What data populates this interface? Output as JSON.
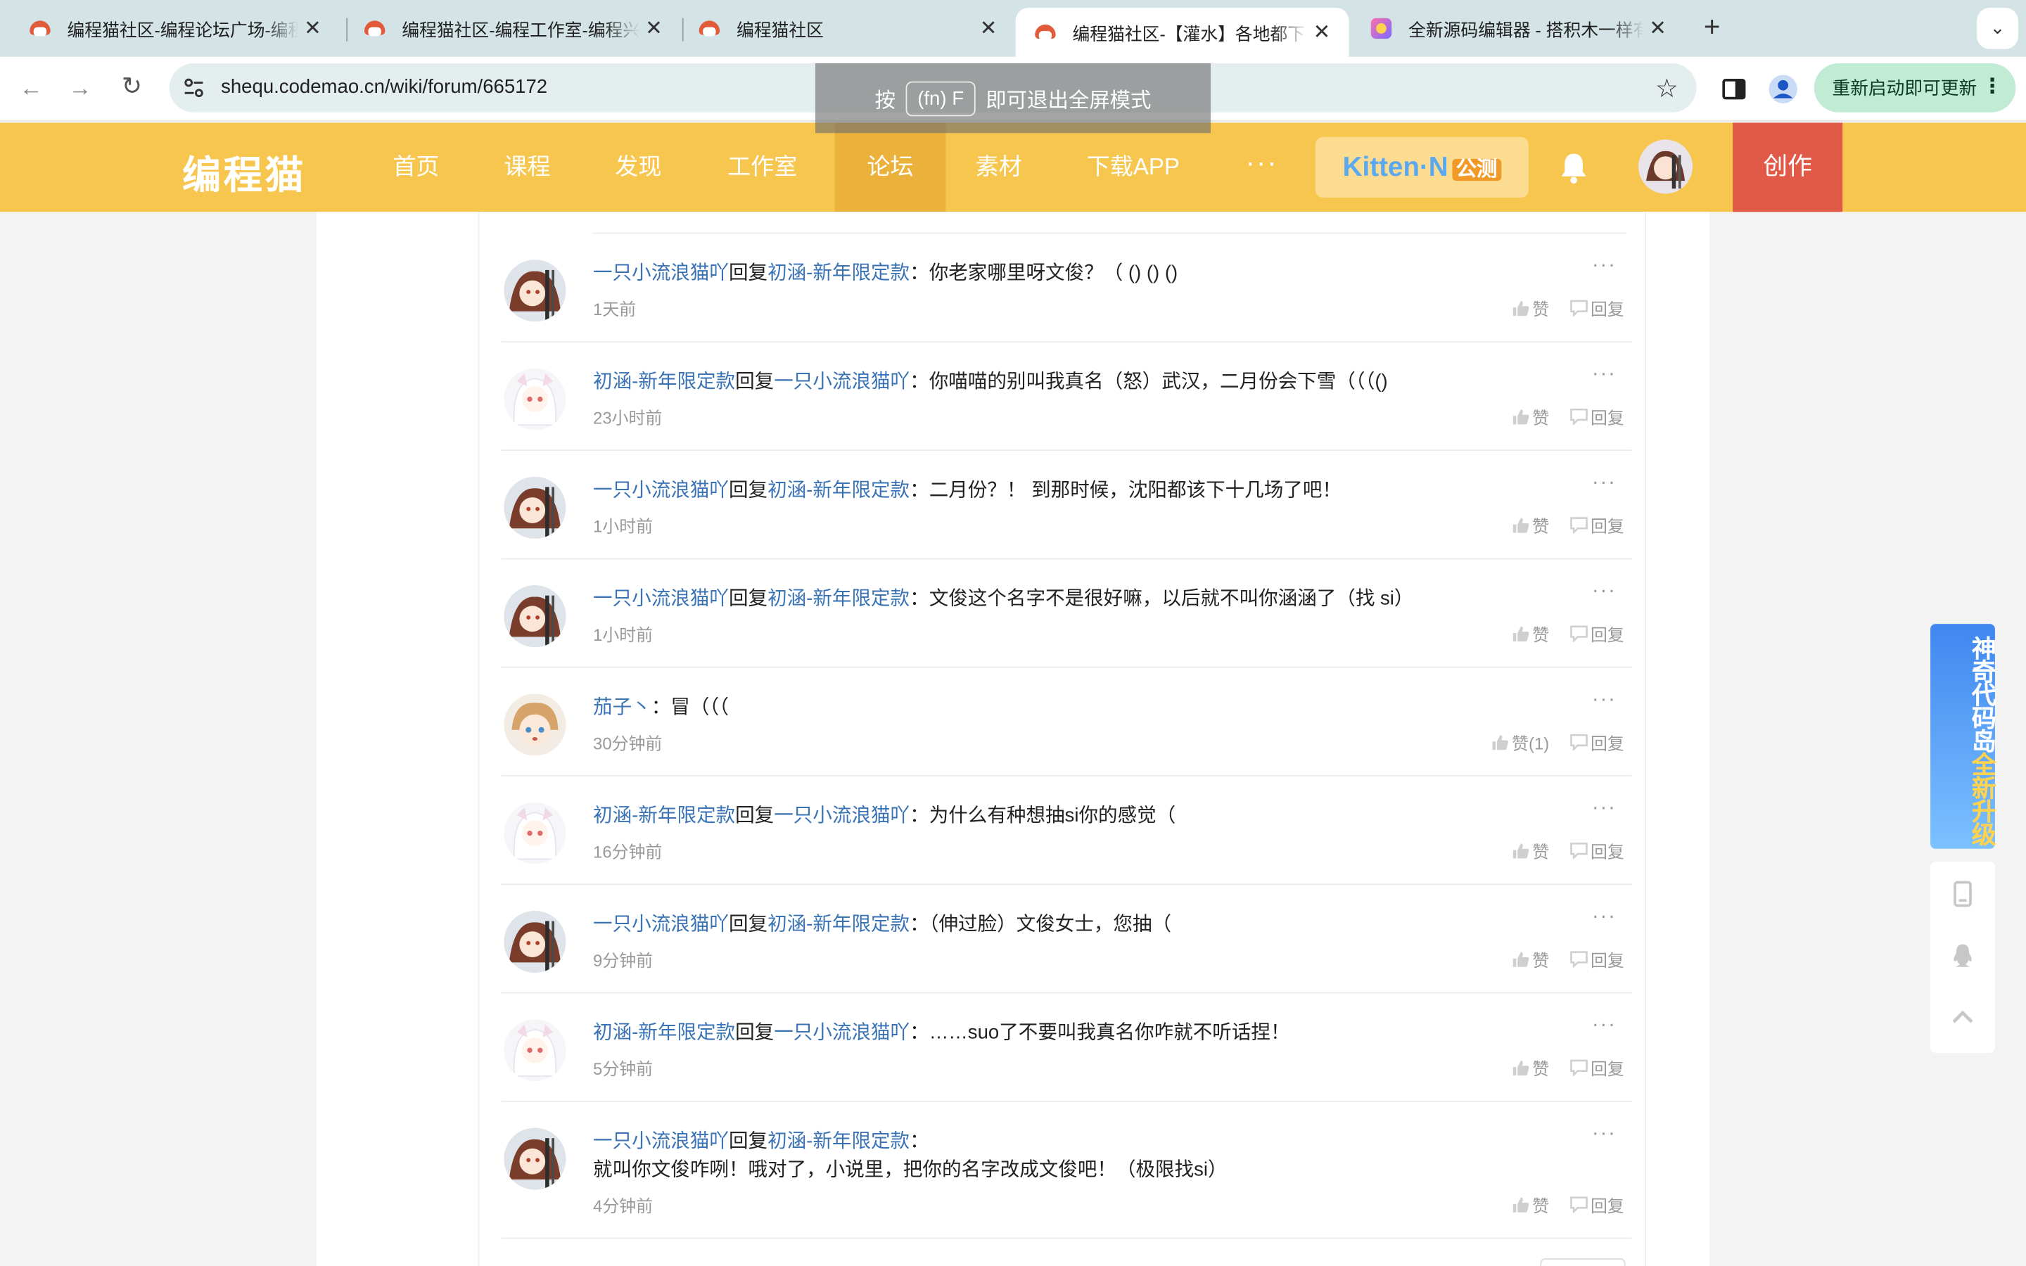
{
  "browser": {
    "tabs": [
      {
        "title": "编程猫社区-编程论坛广场-编程",
        "active": false,
        "favicon": "codemao-icon"
      },
      {
        "title": "编程猫社区-编程工作室-编程兴",
        "active": false,
        "favicon": "codemao-icon"
      },
      {
        "title": "编程猫社区",
        "active": false,
        "favicon": "codemao-icon"
      },
      {
        "title": "编程猫社区-【灌水】各地都下",
        "active": true,
        "favicon": "codemao-icon"
      },
      {
        "title": "全新源码编辑器 - 搭积木一样有",
        "active": false,
        "favicon": "kitten-icon"
      }
    ],
    "url": "shequ.codemao.cn/wiki/forum/665172",
    "update_button": "重新启动即可更新",
    "fullscreen_toast": {
      "prefix": "按",
      "key": "(fn) F",
      "suffix": "即可退出全屏模式"
    }
  },
  "site": {
    "logo": "编程猫",
    "nav": [
      {
        "label": "首页",
        "active": false
      },
      {
        "label": "课程",
        "active": false
      },
      {
        "label": "发现",
        "active": false
      },
      {
        "label": "工作室",
        "active": false
      },
      {
        "label": "论坛",
        "active": true
      },
      {
        "label": "素材",
        "active": false
      },
      {
        "label": "下载APP",
        "active": false
      }
    ],
    "more": "···",
    "kitten_badge": {
      "brand": "Kitten·N",
      "tag": "公测"
    },
    "create_button": "创作"
  },
  "replies": [
    {
      "avatar": "cat-avatar",
      "author": "一只小流浪猫吖",
      "reply_word": "回复",
      "reply_to": "初涵-新年限定款",
      "colon": "：",
      "text": "你老家哪里呀文俊？（ ()  ()  ()",
      "time": "1天前",
      "like": "赞",
      "comment": "回复"
    },
    {
      "avatar": "girl-avatar",
      "author": "初涵-新年限定款",
      "reply_word": "回复",
      "reply_to": "一只小流浪猫吖",
      "colon": "：",
      "text": "你喵喵的别叫我真名（怒）武汉，二月份会下雪（（（()",
      "time": "23小时前",
      "like": "赞",
      "comment": "回复"
    },
    {
      "avatar": "cat-avatar",
      "author": "一只小流浪猫吖",
      "reply_word": "回复",
      "reply_to": "初涵-新年限定款",
      "colon": "：",
      "text": "二月份？！ 到那时候，沈阳都该下十几场了吧！",
      "time": "1小时前",
      "like": "赞",
      "comment": "回复"
    },
    {
      "avatar": "cat-avatar",
      "author": "一只小流浪猫吖",
      "reply_word": "回复",
      "reply_to": "初涵-新年限定款",
      "colon": "：",
      "text": "文俊这个名字不是很好嘛，以后就不叫你涵涵了（找 si）",
      "time": "1小时前",
      "like": "赞",
      "comment": "回复"
    },
    {
      "avatar": "boy-avatar",
      "author": "茄子丶",
      "reply_word": "",
      "reply_to": "",
      "colon": "：",
      "text": "冒（（（",
      "time": "30分钟前",
      "like": "赞(1)",
      "comment": "回复"
    },
    {
      "avatar": "girl-avatar",
      "author": "初涵-新年限定款",
      "reply_word": "回复",
      "reply_to": "一只小流浪猫吖",
      "colon": "：",
      "text": "为什么有种想抽si你的感觉（",
      "time": "16分钟前",
      "like": "赞",
      "comment": "回复"
    },
    {
      "avatar": "cat-avatar",
      "author": "一只小流浪猫吖",
      "reply_word": "回复",
      "reply_to": "初涵-新年限定款",
      "colon": "：",
      "text": "（伸过脸）文俊女士，您抽（",
      "time": "9分钟前",
      "like": "赞",
      "comment": "回复"
    },
    {
      "avatar": "girl-avatar",
      "author": "初涵-新年限定款",
      "reply_word": "回复",
      "reply_to": "一只小流浪猫吖",
      "colon": "：",
      "text": "……suo了不要叫我真名你咋就不听话捏！",
      "time": "5分钟前",
      "like": "赞",
      "comment": "回复"
    },
    {
      "avatar": "cat-avatar",
      "author": "一只小流浪猫吖",
      "reply_word": "回复",
      "reply_to": "初涵-新年限定款",
      "colon": "：",
      "text": "就叫你文俊咋咧！哦对了，小说里，把你的名字改成文俊吧！（极限找si）",
      "time": "4分钟前",
      "like": "赞",
      "comment": "回复"
    }
  ],
  "promo": {
    "line1": "神奇代码岛",
    "line2": "全新升级"
  },
  "colors": {
    "header": "#f7c64f",
    "nav_active": "#ebb13a",
    "create": "#e05a47",
    "link": "#3a73b5"
  }
}
